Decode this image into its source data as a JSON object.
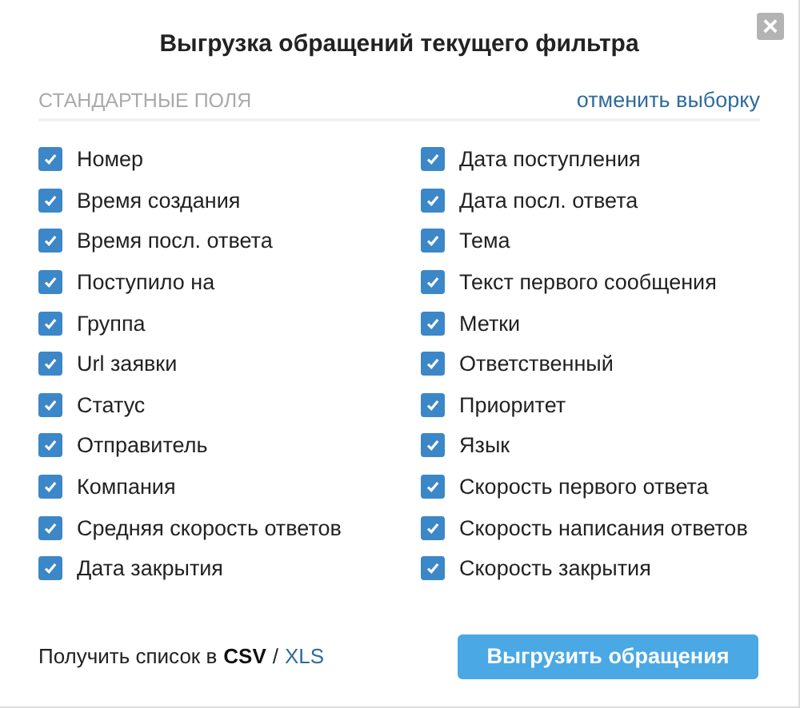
{
  "dialog": {
    "title": "Выгрузка обращений текущего фильтра",
    "close": "×"
  },
  "section": {
    "title": "СТАНДАРТНЫЕ ПОЛЯ",
    "clear_link": "отменить выборку"
  },
  "fields": [
    {
      "label": "Номер",
      "checked": true
    },
    {
      "label": "Время создания",
      "checked": true
    },
    {
      "label": "Время посл. ответа",
      "checked": true
    },
    {
      "label": "Поступило на",
      "checked": true
    },
    {
      "label": "Группа",
      "checked": true
    },
    {
      "label": "Url заявки",
      "checked": true
    },
    {
      "label": "Статус",
      "checked": true
    },
    {
      "label": "Отправитель",
      "checked": true
    },
    {
      "label": "Компания",
      "checked": true
    },
    {
      "label": "Средняя скорость ответов",
      "checked": true
    },
    {
      "label": "Дата закрытия",
      "checked": true
    },
    {
      "label": "Дата поступления",
      "checked": true
    },
    {
      "label": "Дата посл. ответа",
      "checked": true
    },
    {
      "label": "Тема",
      "checked": true
    },
    {
      "label": "Текст первого сообщения",
      "checked": true
    },
    {
      "label": "Метки",
      "checked": true
    },
    {
      "label": "Ответственный",
      "checked": true
    },
    {
      "label": "Приоритет",
      "checked": true
    },
    {
      "label": "Язык",
      "checked": true
    },
    {
      "label": "Скорость первого ответа",
      "checked": true
    },
    {
      "label": "Скорость написания ответов",
      "checked": true
    },
    {
      "label": "Скорость закрытия",
      "checked": true
    }
  ],
  "footer": {
    "label": "Получить список в",
    "separator": "/",
    "formats": [
      {
        "label": "CSV",
        "selected": true
      },
      {
        "label": "XLS",
        "selected": false
      }
    ],
    "submit": "Выгрузить обращения"
  }
}
